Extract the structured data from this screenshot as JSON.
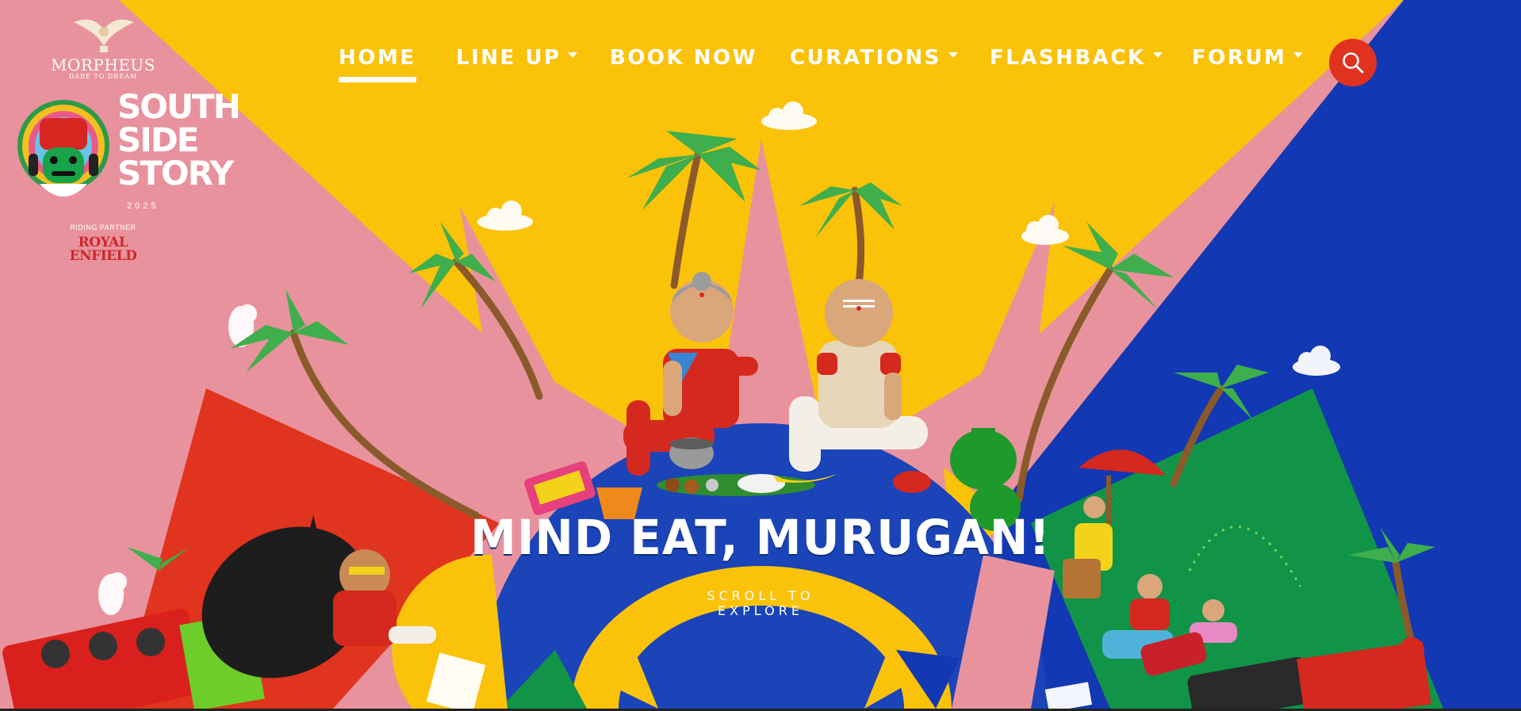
{
  "nav": {
    "items": [
      {
        "label": "HOME",
        "active": true,
        "dropdown": false
      },
      {
        "label": "LINE UP",
        "active": false,
        "dropdown": true
      },
      {
        "label": "BOOK NOW",
        "active": false,
        "dropdown": false
      },
      {
        "label": "CURATIONS",
        "active": false,
        "dropdown": true
      },
      {
        "label": "FLASHBACK",
        "active": false,
        "dropdown": true
      },
      {
        "label": "FORUM",
        "active": false,
        "dropdown": true
      }
    ],
    "search_icon": "search-icon"
  },
  "brand": {
    "sponsor_name": "MORPHEUS",
    "sponsor_tagline": "DARE TO DREAM",
    "festival_logo_text": "SOUTH SIDE STORY",
    "festival_year": "2025",
    "partner_label": "RIDING PARTNER",
    "partner_name": "ROYAL ENFIELD"
  },
  "hero": {
    "headline": "MIND EAT, MURUGAN!",
    "scroll_cta": "SCROLL TO EXPLORE"
  },
  "colors": {
    "pink": "#e8929d",
    "yellow": "#fbc20a",
    "blue": "#1238b4",
    "red": "#e0341e",
    "green": "#119447",
    "search_red": "#e0321f"
  }
}
